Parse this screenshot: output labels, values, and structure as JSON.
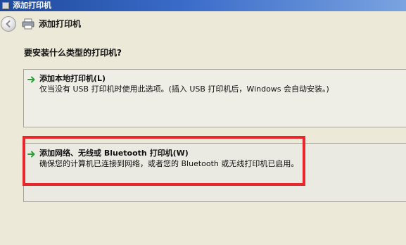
{
  "window": {
    "title": "添加打印机"
  },
  "nav": {
    "title": "添加打印机",
    "back_icon": "back-arrow-icon",
    "printer_icon": "printer-icon"
  },
  "question": "要安装什么类型的打印机?",
  "options": [
    {
      "title": "添加本地打印机(L)",
      "description": "仅当没有 USB 打印机时使用此选项。(插入 USB 打印机后，Windows 会自动安装。)",
      "icon": "green-arrow-icon"
    },
    {
      "title": "添加网络、无线或 Bluetooth 打印机(W)",
      "description": "确保您的计算机已连接到网络，或者您的 Bluetooth 或无线打印机已启用。",
      "icon": "green-arrow-icon"
    }
  ],
  "colors": {
    "titlebar": "#2a5ab5",
    "background": "#ece9d8",
    "highlight": "#e8262b",
    "arrow": "#2e9e3a"
  }
}
